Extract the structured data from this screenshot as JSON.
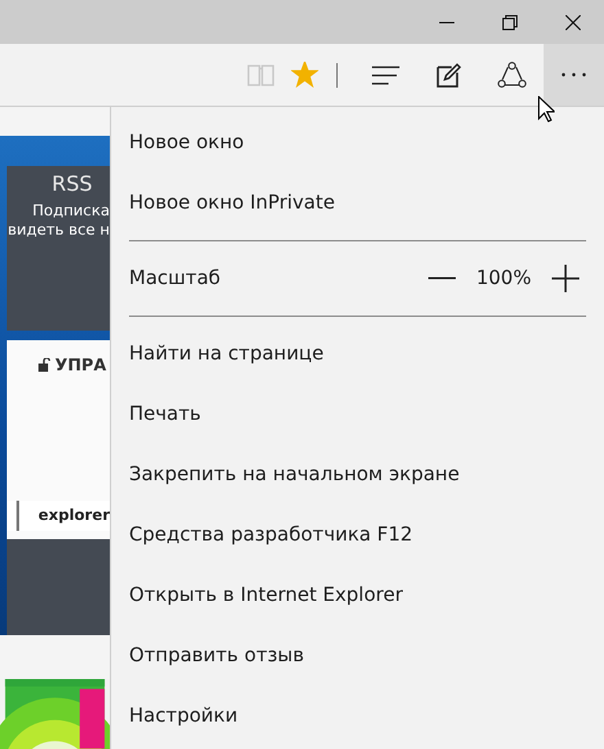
{
  "toolbar": {
    "reading_view": {
      "disabled": true
    },
    "favorite": {
      "on": true
    },
    "more": {
      "selected": true
    }
  },
  "page": {
    "rss_card": {
      "title": "RSS",
      "lines": [
        "Подписка",
        "видеть все н"
      ]
    },
    "panel_heading": "УПРА",
    "link": "explorer"
  },
  "menu": {
    "items": [
      {
        "kind": "item",
        "label": "Новое окно"
      },
      {
        "kind": "item",
        "label": "Новое окно InPrivate"
      },
      {
        "kind": "divider"
      },
      {
        "kind": "zoom",
        "label": "Масштаб",
        "value": "100%"
      },
      {
        "kind": "divider"
      },
      {
        "kind": "item",
        "label": "Найти на странице"
      },
      {
        "kind": "item",
        "label": "Печать"
      },
      {
        "kind": "item",
        "label": "Закрепить на начальном экране"
      },
      {
        "kind": "item",
        "label": "Средства разработчика F12"
      },
      {
        "kind": "item",
        "label": "Открыть в Internet Explorer"
      },
      {
        "kind": "item",
        "label": "Отправить отзыв"
      },
      {
        "kind": "item",
        "label": "Настройки"
      }
    ]
  }
}
